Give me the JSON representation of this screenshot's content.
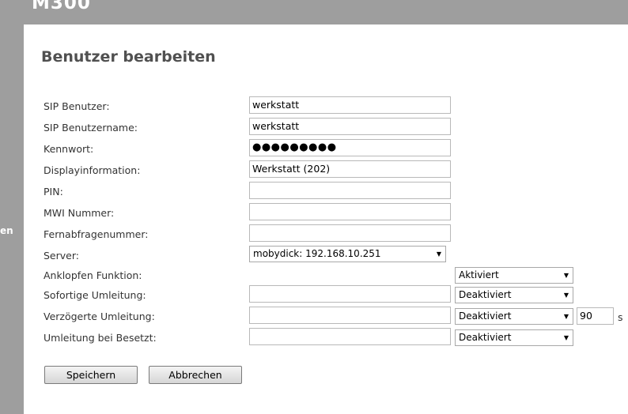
{
  "app": {
    "title": "M300",
    "sidebar_fragment": "en"
  },
  "page": {
    "title": "Benutzer bearbeiten"
  },
  "fields": {
    "sip_user": {
      "label": "SIP Benutzer:",
      "value": "werkstatt"
    },
    "sip_username": {
      "label": "SIP Benutzername:",
      "value": "werkstatt"
    },
    "password": {
      "label": "Kennwort:",
      "value": "●●●●●●●●●"
    },
    "display_info": {
      "label": "Displayinformation:",
      "value": "Werkstatt (202)"
    },
    "pin": {
      "label": "PIN:",
      "value": ""
    },
    "mwi_number": {
      "label": "MWI Nummer:",
      "value": ""
    },
    "remote_query_number": {
      "label": "Fernabfragenummer:",
      "value": ""
    },
    "server": {
      "label": "Server:",
      "selected": "mobydick: 192.168.10.251"
    },
    "call_waiting": {
      "label": "Anklopfen Funktion:",
      "selected": "Aktiviert"
    },
    "forward_immediate": {
      "label": "Sofortige Umleitung:",
      "value": "",
      "selected": "Deaktiviert"
    },
    "forward_delayed": {
      "label": "Verzögerte Umleitung:",
      "value": "",
      "selected": "Deaktiviert",
      "delay": "90",
      "unit": "s"
    },
    "forward_busy": {
      "label": "Umleitung bei Besetzt:",
      "value": "",
      "selected": "Deaktiviert"
    }
  },
  "buttons": {
    "save": "Speichern",
    "cancel": "Abbrechen"
  },
  "icons": {
    "dropdown": "chevron-down-icon"
  }
}
